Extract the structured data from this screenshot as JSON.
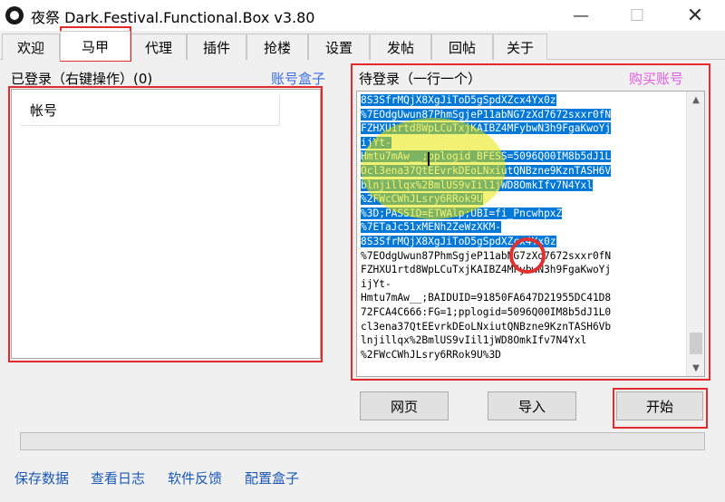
{
  "window": {
    "title": "夜祭 Dark.Festival.Functional.Box v3.80",
    "minimize_glyph": "—",
    "maximize_glyph": "☐",
    "close_glyph": "✕"
  },
  "tabs": [
    {
      "label": "欢迎"
    },
    {
      "label": "马甲",
      "active": true
    },
    {
      "label": "代理"
    },
    {
      "label": "插件"
    },
    {
      "label": "抢楼"
    },
    {
      "label": "设置"
    },
    {
      "label": "发帖"
    },
    {
      "label": "回帖"
    },
    {
      "label": "关于"
    }
  ],
  "left_panel": {
    "title": "已登录（右键操作）(0)",
    "link": "账号盒子",
    "column_header": "帐号"
  },
  "right_panel": {
    "title": "待登录（一行一个）",
    "link": "购买账号",
    "lines": [
      {
        "text": "8S3SfrMQjX8XgJiToD5gSpdXZcx4Yx0z",
        "selected": true
      },
      {
        "text": "%7EOdgUwun87PhmSgjeP11abNG7zXd7672sxxr0fN",
        "selected": true
      },
      {
        "text": "FZHXU1rtd8WpLCuTxjKAIBZ4MFybwN3h9FgaKwoYj",
        "selected": true
      },
      {
        "text": "ijYt-",
        "selected": true
      },
      {
        "text": "Hmtu7mAw__;pplogid_BFESS=5096Q00IM8b5dJ1L",
        "selected": true
      },
      {
        "text": "Ocl3ena37QtEEvrkDEoLNxiutQNBzne9KznTASH6V",
        "selected": true
      },
      {
        "text": "blnjillqx%2BmlUS9vIil1jWD8OmkIfv7N4Yxl",
        "selected": true
      },
      {
        "text": "%2FWcCWhJLsry6RRok9U",
        "selected": true
      },
      {
        "text": "%3D;PASSID=ETWAlp;UBI=fi_PncwhpxZ",
        "selected": true
      },
      {
        "text": "%7ETaJc51xMENh2ZeWzXKM-",
        "selected": true
      },
      {
        "text": "8S3SfrMQjX8XgJiToD5gSpdXZcx4Yx0z",
        "selected": true
      },
      {
        "text": "%7EOdgUwun87PhmSgjeP11abNG7zXd7672sxxr0fN",
        "selected": false
      },
      {
        "text": "FZHXU1rtd8WpLCuTxjKAIBZ4MFybwN3h9FgaKwoYj",
        "selected": false
      },
      {
        "text": "ijYt-",
        "selected": false
      },
      {
        "text": "Hmtu7mAw__;BAIDUID=91850FA647D21955DC41D8",
        "selected": false
      },
      {
        "text": "72FCA4C666:FG=1;pplogid=5096Q00IM8b5dJ1L0",
        "selected": false
      },
      {
        "text": "cl3ena37QtEEvrkDEoLNxiutQNBzne9KznTASH6Vb",
        "selected": false
      },
      {
        "text": "lnjillqx%2BmlUS9vIil1jWD8OmkIfv7N4Yxl",
        "selected": false
      },
      {
        "text": "%2FWcCWhJLsry6RRok9U%3D",
        "selected": false
      }
    ]
  },
  "buttons": {
    "web": "网页",
    "import": "导入",
    "start": "开始"
  },
  "progress": 0,
  "bottom_links": [
    {
      "label": "保存数据"
    },
    {
      "label": "查看日志"
    },
    {
      "label": "软件反馈"
    },
    {
      "label": "配置盒子"
    }
  ],
  "colors": {
    "highlight_box": "#e42b2b",
    "selection": "#0078d7",
    "link_blue": "#3b6ce0",
    "link_pink": "#e15be0"
  }
}
